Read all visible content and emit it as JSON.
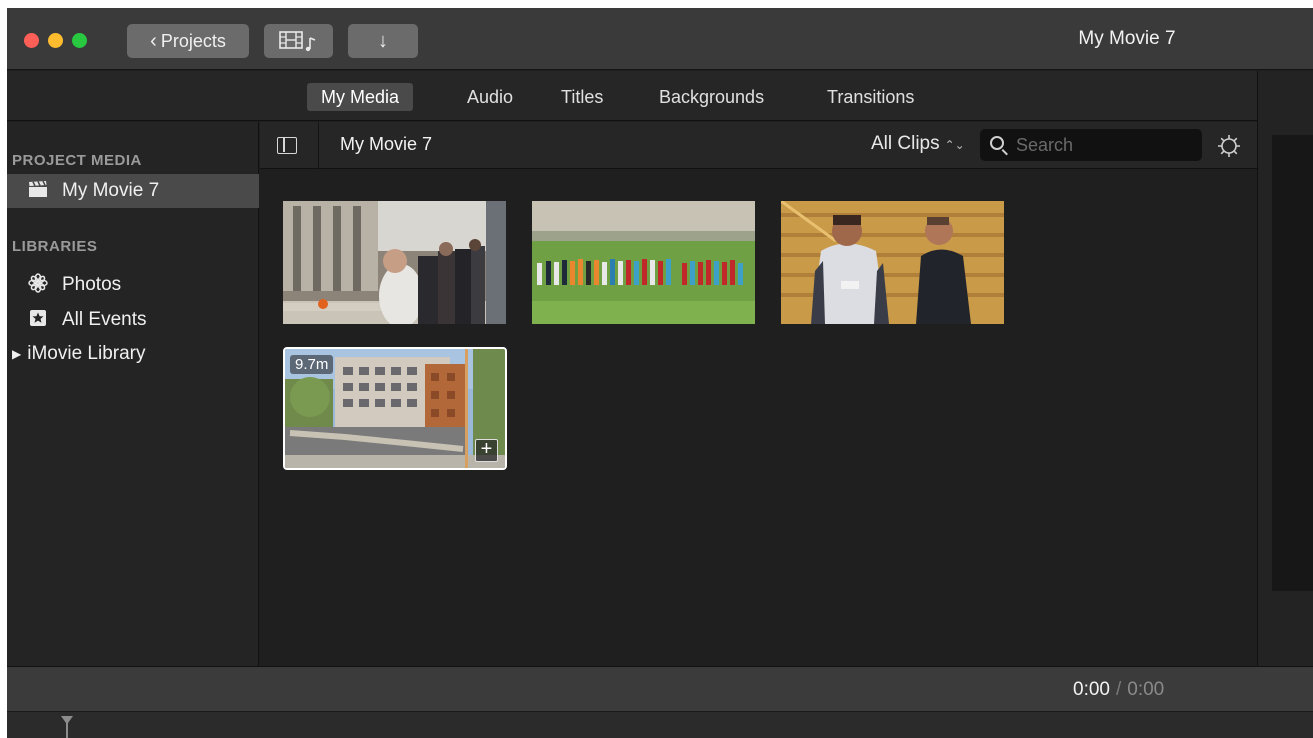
{
  "titlebar": {
    "projects_label": "Projects",
    "window_title": "My Movie 7"
  },
  "tabs": [
    {
      "label": "My Media",
      "active": true
    },
    {
      "label": "Audio",
      "active": false
    },
    {
      "label": "Titles",
      "active": false
    },
    {
      "label": "Backgrounds",
      "active": false
    },
    {
      "label": "Transitions",
      "active": false
    }
  ],
  "sidebar": {
    "project_media_heading": "PROJECT MEDIA",
    "project_item": "My Movie 7",
    "libraries_heading": "LIBRARIES",
    "items": [
      {
        "label": "Photos",
        "icon": "flower-icon"
      },
      {
        "label": "All Events",
        "icon": "star-box-icon"
      },
      {
        "label": "iMovie Library",
        "icon": "disclosure-triangle-icon"
      }
    ]
  },
  "browser": {
    "title": "My Movie 7",
    "filter_label": "All Clips",
    "search_placeholder": "Search"
  },
  "clips": [
    {
      "scene": "indoor group of people in a room"
    },
    {
      "scene": "soccer teams lined up on a field"
    },
    {
      "scene": "two men in a gymnasium"
    },
    {
      "scene": "building exterior with sign",
      "duration": "9.7m",
      "selected": true
    }
  ],
  "timecode": {
    "current": "0:00",
    "total": "0:00"
  },
  "colors": {
    "close": "#ff5f57",
    "minimize": "#febc2e",
    "maximize": "#28c840",
    "clip_selection": "#ffffff"
  }
}
